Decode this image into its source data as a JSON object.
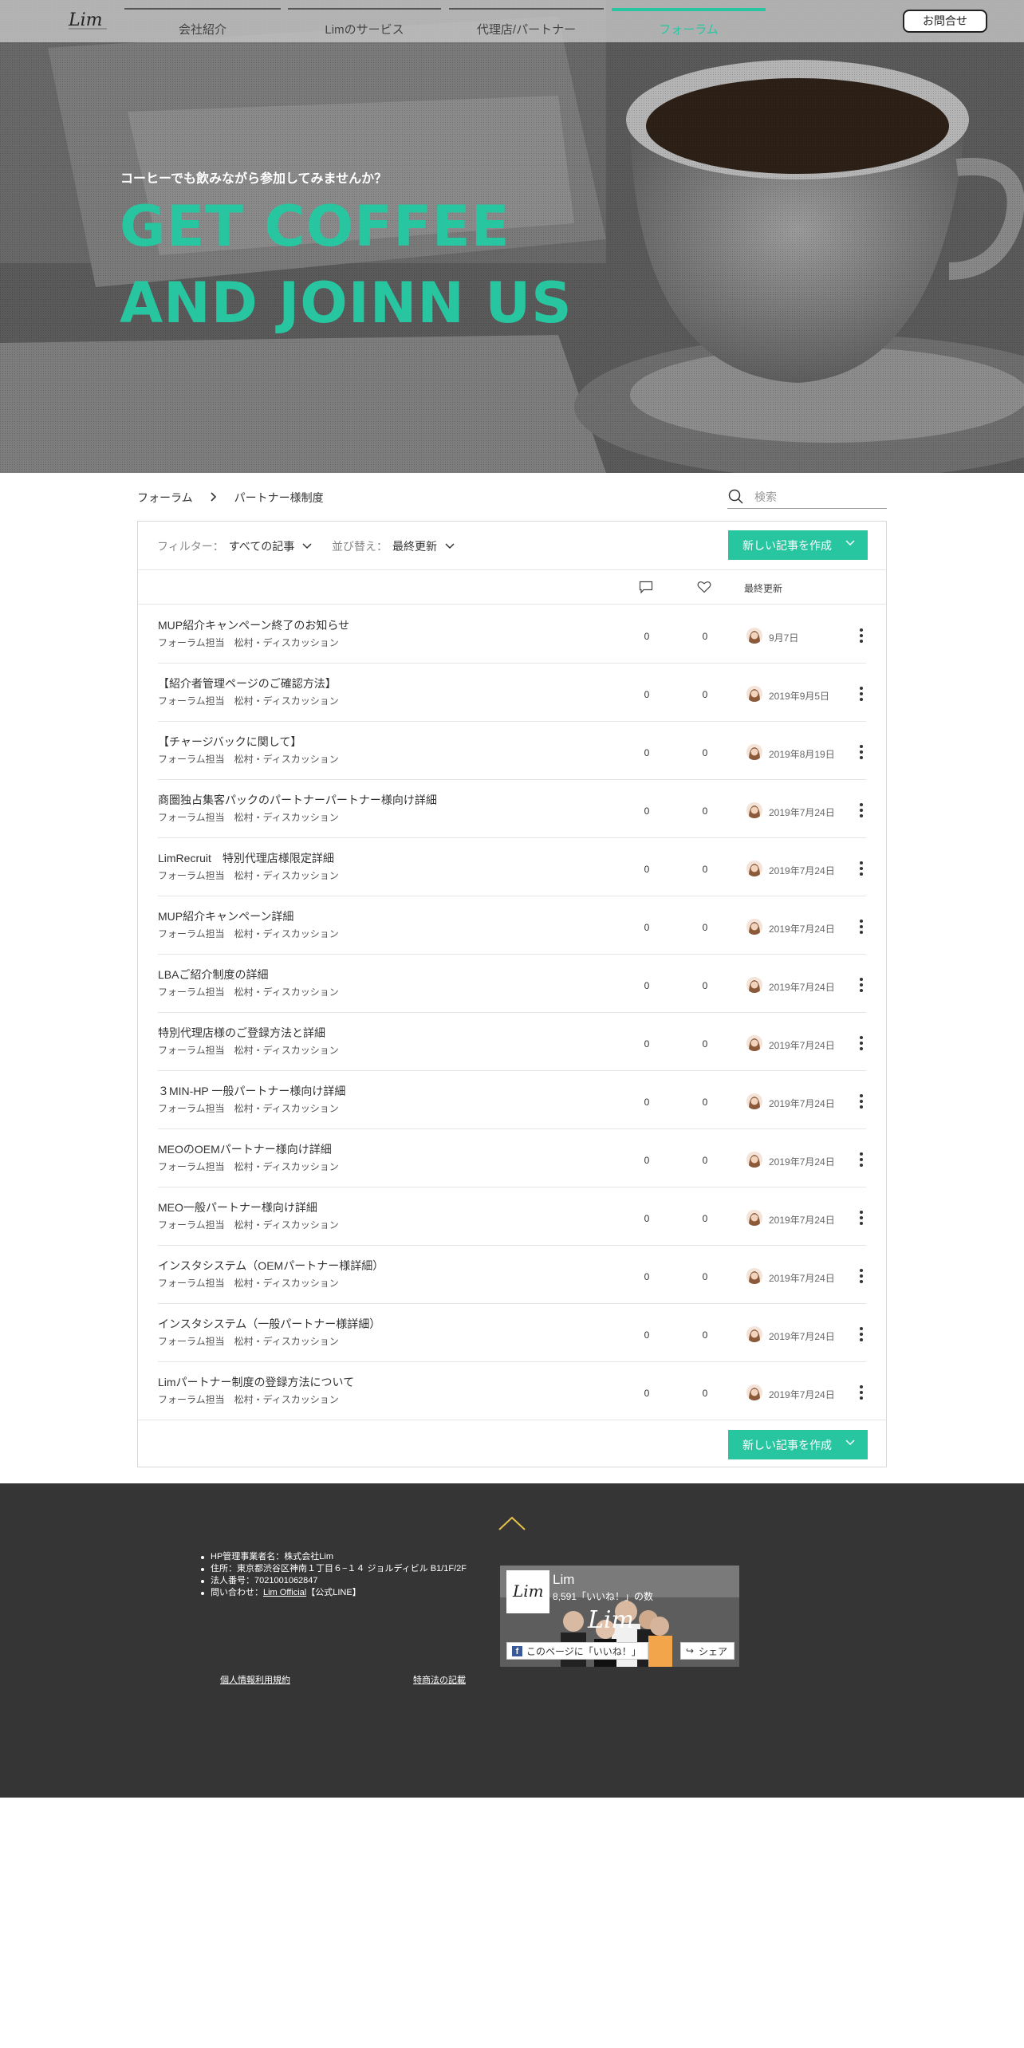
{
  "nav": {
    "items": [
      {
        "label": "会社紹介"
      },
      {
        "label": "Limのサービス"
      },
      {
        "label": "代理店/パートナー"
      },
      {
        "label": "フォーラム",
        "active": true
      }
    ],
    "contact_label": "お問合せ"
  },
  "hero": {
    "subtitle": "コーヒーでも飲みながら参加してみませんか？",
    "title_line1": "GET COFFEE",
    "title_line2": "AND JOINN US"
  },
  "forum": {
    "breadcrumb_root": "フォーラム",
    "breadcrumb_current": "パートナー様制度",
    "search_placeholder": "検索",
    "filter_label": "フィルター：",
    "filter_value": "すべての記事",
    "sort_label": "並び替え：",
    "sort_value": "最終更新",
    "new_post_label": "新しい記事を作成",
    "col_last_updated": "最終更新",
    "posts": [
      {
        "title": "MUP紹介キャンペーン終了のお知らせ",
        "meta": "フォーラム担当　松村・ディスカッション",
        "comments": "0",
        "likes": "0",
        "date": "9月7日"
      },
      {
        "title": "【紹介者管理ページのご確認方法】",
        "meta": "フォーラム担当　松村・ディスカッション",
        "comments": "0",
        "likes": "0",
        "date": "2019年9月5日"
      },
      {
        "title": "【チャージバックに関して】",
        "meta": "フォーラム担当　松村・ディスカッション",
        "comments": "0",
        "likes": "0",
        "date": "2019年8月19日"
      },
      {
        "title": "商圏独占集客パックのパートナーパートナー様向け詳細",
        "meta": "フォーラム担当　松村・ディスカッション",
        "comments": "0",
        "likes": "0",
        "date": "2019年7月24日"
      },
      {
        "title": "LimRecruit　特別代理店様限定詳細",
        "meta": "フォーラム担当　松村・ディスカッション",
        "comments": "0",
        "likes": "0",
        "date": "2019年7月24日"
      },
      {
        "title": "MUP紹介キャンペーン詳細",
        "meta": "フォーラム担当　松村・ディスカッション",
        "comments": "0",
        "likes": "0",
        "date": "2019年7月24日"
      },
      {
        "title": "LBAご紹介制度の詳細",
        "meta": "フォーラム担当　松村・ディスカッション",
        "comments": "0",
        "likes": "0",
        "date": "2019年7月24日"
      },
      {
        "title": "特別代理店様のご登録方法と詳細",
        "meta": "フォーラム担当　松村・ディスカッション",
        "comments": "0",
        "likes": "0",
        "date": "2019年7月24日"
      },
      {
        "title": "３MIN-HP 一般パートナー様向け詳細",
        "meta": "フォーラム担当　松村・ディスカッション",
        "comments": "0",
        "likes": "0",
        "date": "2019年7月24日"
      },
      {
        "title": "MEOのOEMパートナー様向け詳細",
        "meta": "フォーラム担当　松村・ディスカッション",
        "comments": "0",
        "likes": "0",
        "date": "2019年7月24日"
      },
      {
        "title": "MEO一般パートナー様向け詳細",
        "meta": "フォーラム担当　松村・ディスカッション",
        "comments": "0",
        "likes": "0",
        "date": "2019年7月24日"
      },
      {
        "title": "インスタシステム（OEMパートナー様詳細）",
        "meta": "フォーラム担当　松村・ディスカッション",
        "comments": "0",
        "likes": "0",
        "date": "2019年7月24日"
      },
      {
        "title": "インスタシステム（一般パートナー様詳細）",
        "meta": "フォーラム担当　松村・ディスカッション",
        "comments": "0",
        "likes": "0",
        "date": "2019年7月24日"
      },
      {
        "title": "Limパートナー制度の登録方法について",
        "meta": "フォーラム担当　松村・ディスカッション",
        "comments": "0",
        "likes": "0",
        "date": "2019年7月24日"
      }
    ]
  },
  "footer": {
    "info": [
      "HP管理事業者名：株式会社Lim",
      "住所：東京都渋谷区神南１丁目６−１４ ジョルディビル B1/1F/2F",
      "法人番号：7021001062847"
    ],
    "inquiry_prefix": "問い合わせ：",
    "inquiry_link": "Lim Official",
    "inquiry_suffix": "【公式LINE】",
    "privacy_link": "個人情報利用規約",
    "law_link": "特商法の記載",
    "fb_name": "Lim",
    "fb_likes": "8,591「いいね！」の数",
    "fb_like_label": "このページに「いいね！」",
    "fb_share_label": "シェア"
  },
  "colors": {
    "accent": "#27c6a1",
    "footer_bg": "#353535"
  }
}
